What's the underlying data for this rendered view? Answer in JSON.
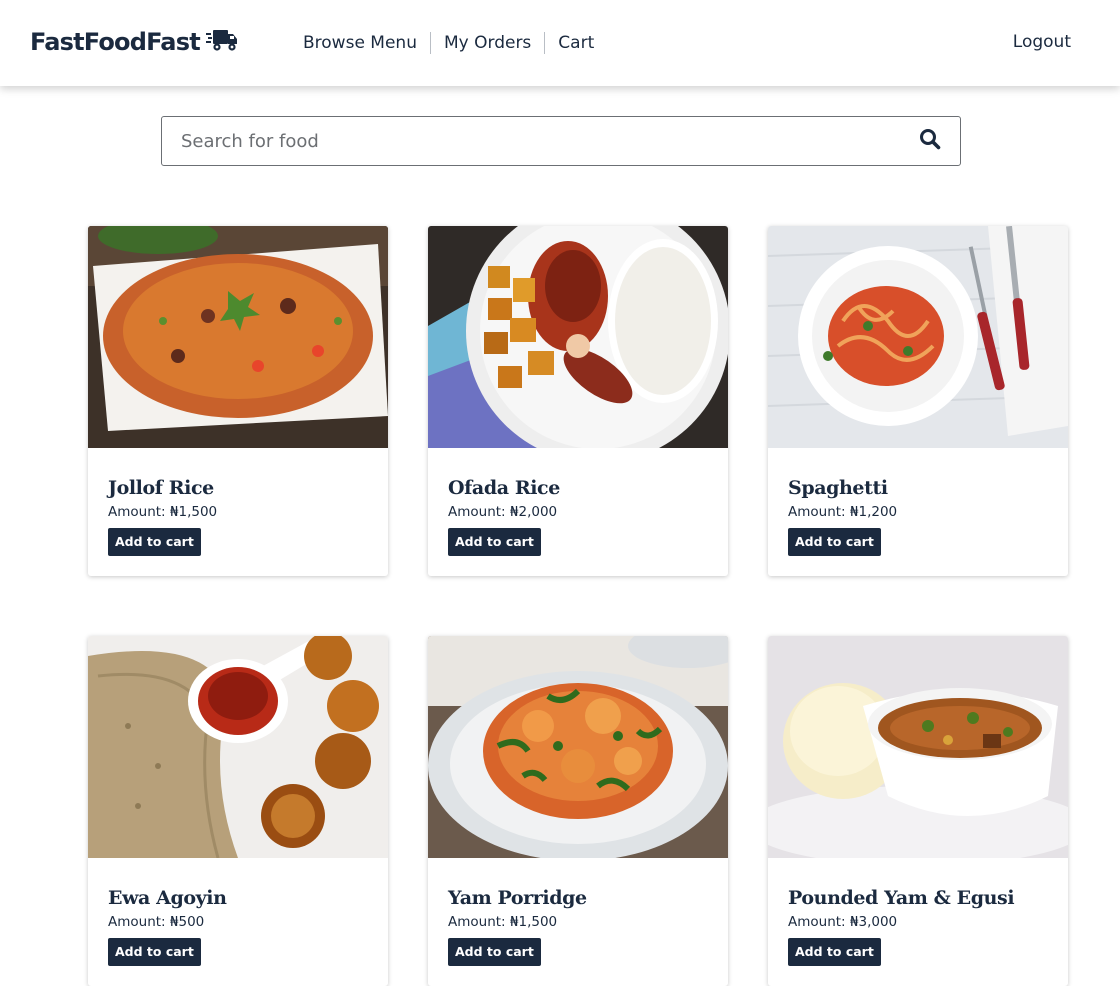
{
  "header": {
    "logo_text": "FastFoodFast",
    "logo_icon": "delivery-truck-icon",
    "nav": [
      {
        "label": "Browse Menu"
      },
      {
        "label": "My Orders"
      },
      {
        "label": "Cart"
      }
    ],
    "logout_label": "Logout"
  },
  "search": {
    "placeholder": "Search for food",
    "value": "",
    "icon": "search-icon"
  },
  "menu": {
    "amount_label": "Amount:",
    "add_label": "Add to cart",
    "items": [
      {
        "name": "Jollof Rice",
        "price": "₦1,500",
        "image": "jollof-rice-photo"
      },
      {
        "name": "Ofada Rice",
        "price": "₦2,000",
        "image": "ofada-rice-photo"
      },
      {
        "name": "Spaghetti",
        "price": "₦1,200",
        "image": "spaghetti-photo"
      },
      {
        "name": "Ewa Agoyin",
        "price": "₦500",
        "image": "ewa-agoyin-photo"
      },
      {
        "name": "Yam Porridge",
        "price": "₦1,500",
        "image": "yam-porridge-photo"
      },
      {
        "name": "Pounded Yam & Egusi",
        "price": "₦3,000",
        "image": "pounded-yam-egusi-photo"
      }
    ]
  },
  "colors": {
    "brand_navy": "#1b2a3f",
    "background": "#ffffff"
  }
}
